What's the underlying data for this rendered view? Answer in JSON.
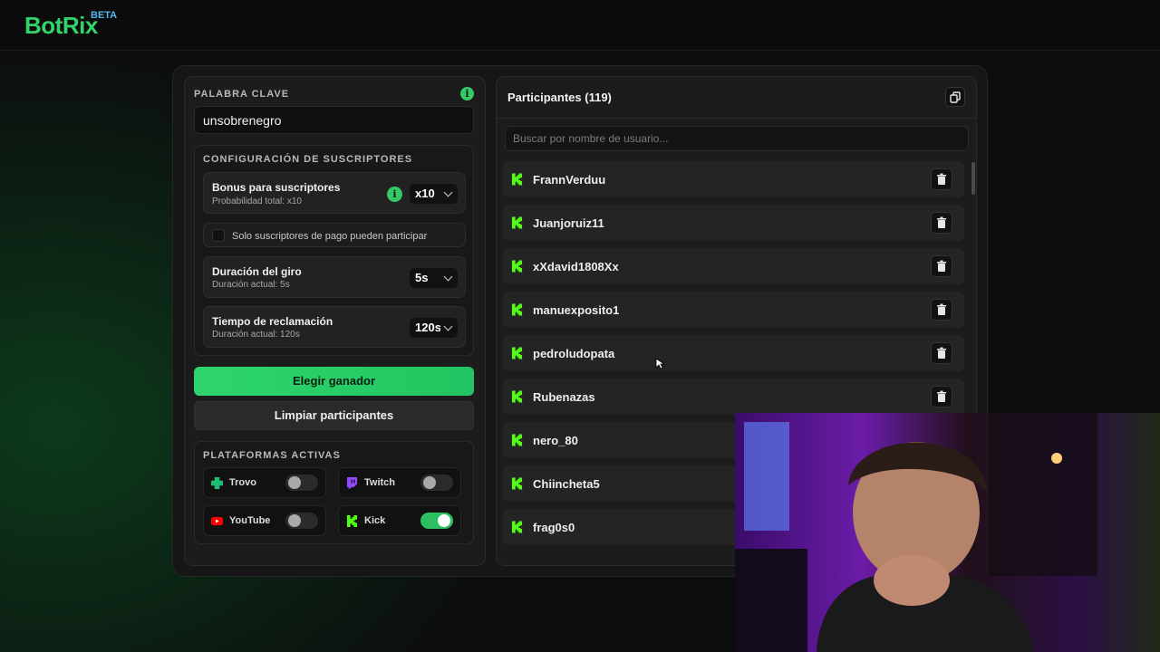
{
  "brand": {
    "name": "BotRix",
    "badge": "BETA"
  },
  "keyword": {
    "label": "PALABRA CLAVE",
    "value": "unsobrenegro"
  },
  "subscribers": {
    "label": "CONFIGURACIÓN DE SUSCRIPTORES",
    "bonus": {
      "title": "Bonus para suscriptores",
      "subtitle": "Probabilidad total: x10",
      "value": "x10"
    },
    "paid_only": {
      "label": "Solo suscriptores de pago pueden participar",
      "checked": false
    },
    "spin_duration": {
      "title": "Duración del giro",
      "subtitle": "Duración actual: 5s",
      "value": "5s"
    },
    "claim_time": {
      "title": "Tiempo de reclamación",
      "subtitle": "Duración actual: 120s",
      "value": "120s"
    }
  },
  "actions": {
    "pick_winner": "Elegir ganador",
    "clear_participants": "Limpiar participantes"
  },
  "platforms": {
    "label": "PLATAFORMAS ACTIVAS",
    "items": [
      {
        "name": "Trovo",
        "icon": "trovo-icon",
        "enabled": false,
        "color": "#1dbf73"
      },
      {
        "name": "Twitch",
        "icon": "twitch-icon",
        "enabled": false,
        "color": "#9146ff"
      },
      {
        "name": "YouTube",
        "icon": "youtube-icon",
        "enabled": false,
        "color": "#ff0000"
      },
      {
        "name": "Kick",
        "icon": "kick-icon",
        "enabled": true,
        "color": "#53fc18"
      }
    ]
  },
  "participants": {
    "title": "Participantes (119)",
    "search_placeholder": "Buscar por nombre de usuario...",
    "users": [
      "FrannVerduu",
      "Juanjoruiz11",
      "xXdavid1808Xx",
      "manuexposito1",
      "pedroludopata",
      "Rubenazas",
      "nero_80",
      "Chiincheta5",
      "frag0s0"
    ]
  },
  "colors": {
    "accent": "#2fd56c",
    "kick": "#53fc18",
    "background": "#0c0d0d"
  }
}
